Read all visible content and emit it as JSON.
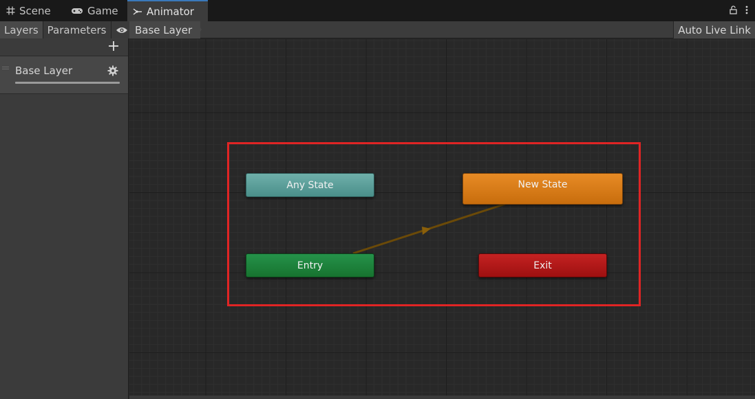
{
  "tabs": [
    {
      "label": "Scene",
      "icon": "grid-icon"
    },
    {
      "label": "Game",
      "icon": "gamepad-icon"
    },
    {
      "label": "Animator",
      "icon": "animator-icon",
      "active": true
    }
  ],
  "left_panel": {
    "tabs": [
      {
        "label": "Layers",
        "active": true
      },
      {
        "label": "Parameters",
        "active": false
      }
    ],
    "eye_icon": "eye-icon",
    "add_icon": "plus-icon",
    "layers": [
      {
        "name": "Base Layer",
        "weight": 1.0
      }
    ]
  },
  "breadcrumb": {
    "label": "Base Layer"
  },
  "auto_live_link": "Auto Live Link",
  "graph": {
    "states": {
      "any_state": "Any State",
      "new_state": "New State",
      "entry": "Entry",
      "exit": "Exit"
    },
    "transitions": [
      {
        "from": "Entry",
        "to": "New State",
        "color": "#6b4a08"
      }
    ]
  },
  "colors": {
    "any_state": "#5a9e99",
    "new_state": "#d97a16",
    "entry": "#1e8440",
    "exit": "#b41818",
    "highlight": "#e02424",
    "active_tab_accent": "#3a79bb"
  }
}
